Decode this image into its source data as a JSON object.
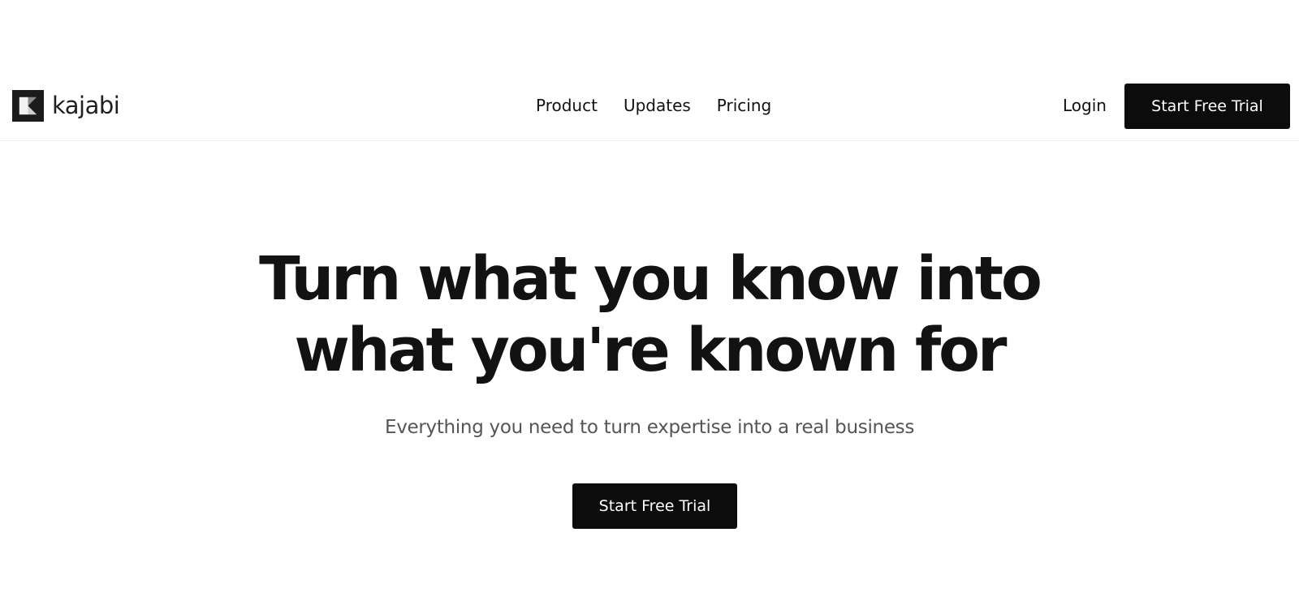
{
  "brand": {
    "name": "kajabi",
    "logo_icon": "kajabi-k-mark"
  },
  "nav": {
    "items": [
      {
        "label": "Product"
      },
      {
        "label": "Updates"
      },
      {
        "label": "Pricing"
      }
    ],
    "login_label": "Login",
    "cta_label": "Start Free Trial"
  },
  "hero": {
    "title_line1": "Turn what you know into",
    "title_line2": "what you're known for",
    "subtitle": "Everything you need to turn expertise into a real business",
    "cta_label": "Start Free Trial"
  },
  "colors": {
    "primary_button": "#0c0c0c",
    "button_text": "#ffffff",
    "subtitle_text": "#555555"
  }
}
